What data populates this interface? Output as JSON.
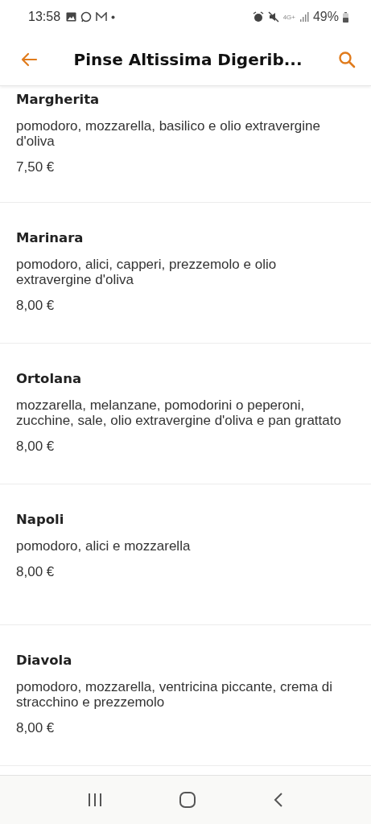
{
  "status_bar": {
    "time": "13:58",
    "network": "4G+",
    "battery": "49%"
  },
  "header": {
    "title": "Pinse Altissima Digerib..."
  },
  "items": [
    {
      "name": "Margherita",
      "description": "pomodoro, mozzarella, basilico e olio extravergine d'oliva",
      "price": "7,50 €"
    },
    {
      "name": "Marinara",
      "description": "pomodoro, alici, capperi, prezzemolo e olio extravergine d'oliva",
      "price": "8,00 €"
    },
    {
      "name": "Ortolana",
      "description": "mozzarella, melanzane, pomodorini o peperoni, zucchine, sale, olio extravergine d'oliva e pan grattato",
      "price": "8,00 €"
    },
    {
      "name": "Napoli",
      "description": "pomodoro, alici e mozzarella",
      "price": "8,00 €"
    },
    {
      "name": "Diavola",
      "description": "pomodoro, mozzarella, ventricina piccante, crema di stracchino e prezzemolo",
      "price": "8,00 €"
    }
  ]
}
